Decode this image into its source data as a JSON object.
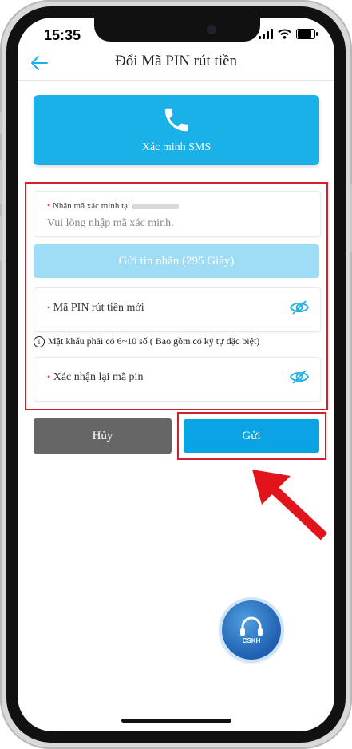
{
  "status_bar": {
    "time": "15:35"
  },
  "header": {
    "title": "Đổi Mã PIN rút tiền"
  },
  "sms_card": {
    "label": "Xác minh SMS"
  },
  "verify_field": {
    "label": "Nhận mã xác minh tại",
    "placeholder": "Vui lòng nhập mã xác minh."
  },
  "send_sms_button": {
    "label": "Gửi tin nhắn (295 Giây)"
  },
  "new_pin_field": {
    "label": "Mã PIN rút tiền mới"
  },
  "hint": {
    "text": "Mật khẩu phải có 6~10 số ( Bao gồm có ký tự đặc biệt)"
  },
  "confirm_pin_field": {
    "label": "Xác nhận lại mã pin"
  },
  "actions": {
    "cancel_label": "Hủy",
    "submit_label": "Gửi"
  },
  "support": {
    "label": "CSKH"
  },
  "colors": {
    "accent": "#1ab0e8",
    "submit": "#0aa3e3",
    "highlight": "#d21f2b",
    "cancel": "#666666"
  }
}
